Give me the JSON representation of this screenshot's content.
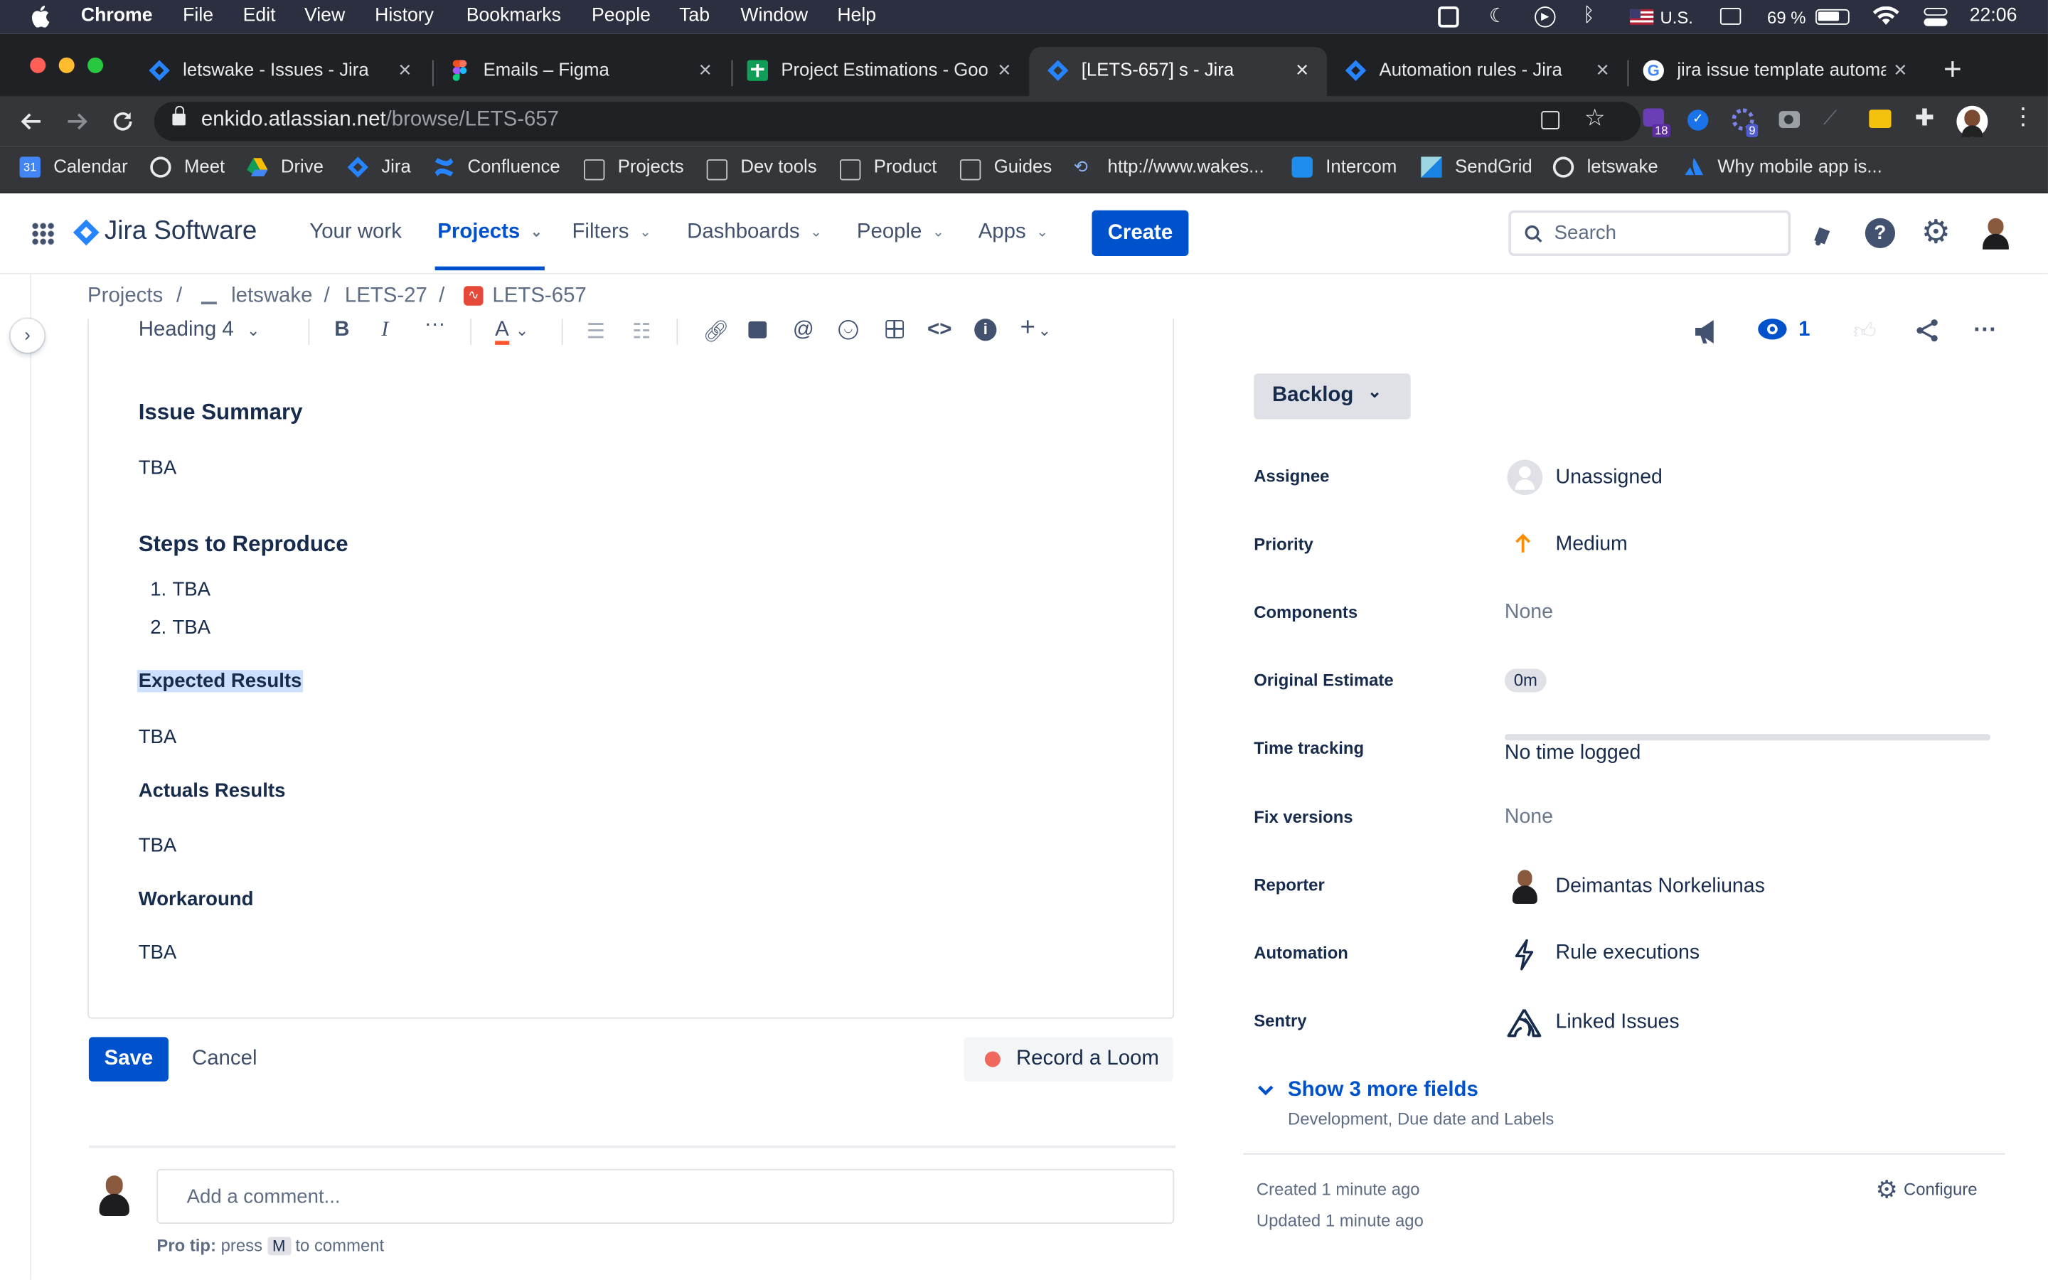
{
  "mac_menu": {
    "apple": "",
    "app": "Chrome",
    "items": [
      "File",
      "Edit",
      "View",
      "History",
      "Bookmarks",
      "People",
      "Tab",
      "Window",
      "Help"
    ],
    "input_source": "U.S.",
    "battery": "69 %",
    "time": "22:06"
  },
  "tabs": [
    {
      "title": "letswake - Issues - Jira",
      "icon": "jira-icon"
    },
    {
      "title": "Emails – Figma",
      "icon": "figma-icon"
    },
    {
      "title": "Project Estimations - Goo",
      "icon": "sheets-icon"
    },
    {
      "title": "[LETS-657] s - Jira",
      "icon": "jira-icon",
      "active": true
    },
    {
      "title": "Automation rules - Jira",
      "icon": "jira-icon"
    },
    {
      "title": "jira issue template automa",
      "icon": "google-icon"
    }
  ],
  "url": {
    "host": "enkido.atlassian.net",
    "path": "/browse/LETS-657"
  },
  "extensions": {
    "badge_a": "18",
    "badge_b": "9"
  },
  "bookmarks": [
    "Calendar",
    "Meet",
    "Drive",
    "Jira",
    "Confluence",
    "Projects",
    "Dev tools",
    "Product",
    "Guides",
    "http://www.wakes...",
    "Intercom",
    "SendGrid",
    "letswake",
    "Why mobile app is..."
  ],
  "jira_nav": {
    "product": "Jira Software",
    "items": [
      "Your work",
      "Projects",
      "Filters",
      "Dashboards",
      "People",
      "Apps"
    ],
    "create": "Create",
    "search_placeholder": "Search"
  },
  "breadcrumb": [
    "Projects",
    "/",
    "letswake",
    "/",
    "LETS-27",
    "/",
    "LETS-657"
  ],
  "editor_toolbar": {
    "text_style": "Heading 4"
  },
  "description": {
    "h_issue_summary": "Issue Summary",
    "p1": "TBA",
    "h_steps": "Steps to Reproduce",
    "steps": [
      "TBA",
      "TBA"
    ],
    "step_nums": [
      "1.",
      "2."
    ],
    "h_expected": "Expected Results",
    "p2": "TBA",
    "h_actual": "Actuals Results",
    "p3": "TBA",
    "h_workaround": "Workaround",
    "p4": "TBA"
  },
  "actions": {
    "save": "Save",
    "cancel": "Cancel",
    "loom": "Record a Loom"
  },
  "comment": {
    "placeholder": "Add a comment...",
    "tip_prefix": "Pro tip:",
    "tip_mid": "press",
    "tip_key": "M",
    "tip_suffix": "to comment"
  },
  "issue_header": {
    "watchers": "1"
  },
  "status": "Backlog",
  "fields": {
    "assignee_label": "Assignee",
    "assignee": "Unassigned",
    "priority_label": "Priority",
    "priority": "Medium",
    "components_label": "Components",
    "components": "None",
    "estimate_label": "Original Estimate",
    "estimate": "0m",
    "tracking_label": "Time tracking",
    "tracking": "No time logged",
    "fixver_label": "Fix versions",
    "fixver": "None",
    "reporter_label": "Reporter",
    "reporter": "Deimantas Norkeliunas",
    "automation_label": "Automation",
    "automation": "Rule executions",
    "sentry_label": "Sentry",
    "sentry": "Linked Issues"
  },
  "more_fields": {
    "link": "Show 3 more fields",
    "sub": "Development, Due date and Labels"
  },
  "meta": {
    "created": "Created 1 minute ago",
    "updated": "Updated 1 minute ago",
    "configure": "Configure"
  },
  "colors": {
    "brand": "#0052cc",
    "priority_medium": "#ff8b00",
    "highlight": "#cce0ff"
  }
}
